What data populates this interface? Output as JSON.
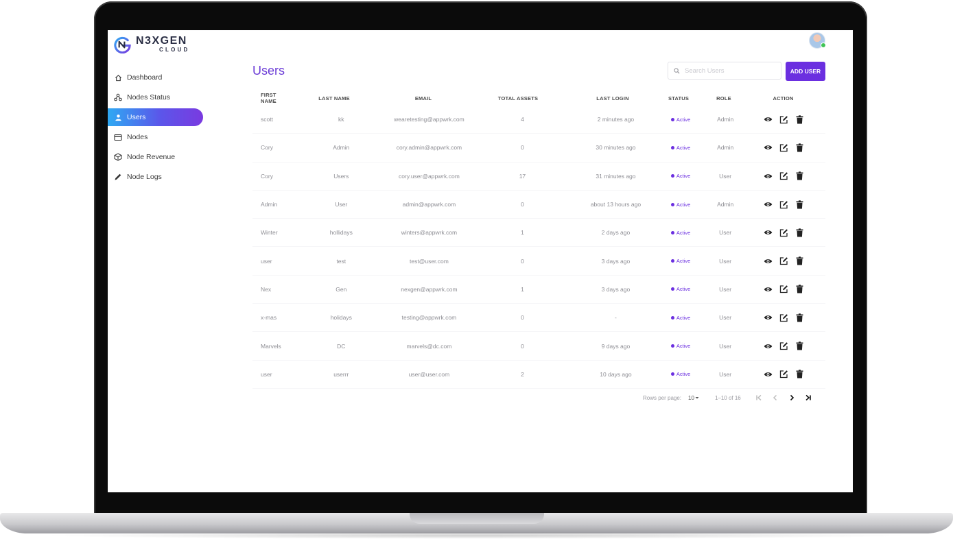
{
  "brand": {
    "name": "N3XGEN",
    "sub": "CLOUD",
    "accent": "#6b2fe0",
    "gradient_start": "#2fa9f3",
    "gradient_end": "#7a3ae0"
  },
  "sidebar": {
    "items": [
      {
        "label": "Dashboard",
        "icon": "home-icon"
      },
      {
        "label": "Nodes Status",
        "icon": "nodes-icon"
      },
      {
        "label": "Users",
        "icon": "user-icon",
        "active": true
      },
      {
        "label": "Nodes",
        "icon": "card-icon"
      },
      {
        "label": "Node Revenue",
        "icon": "cube-icon"
      },
      {
        "label": "Node Logs",
        "icon": "pencil-icon"
      }
    ]
  },
  "page": {
    "title": "Users"
  },
  "search": {
    "placeholder": "Search Users"
  },
  "toolbar": {
    "add_label": "ADD USER"
  },
  "table": {
    "columns": [
      "FIRST NAME",
      "LAST NAME",
      "EMAIL",
      "TOTAL ASSETS",
      "LAST LOGIN",
      "STATUS",
      "ROLE",
      "ACTION"
    ],
    "rows": [
      {
        "first": "scott",
        "last": "kk",
        "email": "wearetesting@appwrk.com",
        "assets": "4",
        "login": "2 minutes ago",
        "status": "Active",
        "role": "Admin"
      },
      {
        "first": "Cory",
        "last": "Admin",
        "email": "cory.admin@appwrk.com",
        "assets": "0",
        "login": "30 minutes ago",
        "status": "Active",
        "role": "Admin"
      },
      {
        "first": "Cory",
        "last": "Users",
        "email": "cory.user@appwrk.com",
        "assets": "17",
        "login": "31 minutes ago",
        "status": "Active",
        "role": "User"
      },
      {
        "first": "Admin",
        "last": "User",
        "email": "admin@appwrk.com",
        "assets": "0",
        "login": "about 13 hours ago",
        "status": "Active",
        "role": "Admin"
      },
      {
        "first": "Winter",
        "last": "hollidays",
        "email": "winters@appwrk.com",
        "assets": "1",
        "login": "2 days ago",
        "status": "Active",
        "role": "User"
      },
      {
        "first": "user",
        "last": "test",
        "email": "test@user.com",
        "assets": "0",
        "login": "3 days ago",
        "status": "Active",
        "role": "User"
      },
      {
        "first": "Nex",
        "last": "Gen",
        "email": "nexgen@appwrk.com",
        "assets": "1",
        "login": "3 days ago",
        "status": "Active",
        "role": "User"
      },
      {
        "first": "x-mas",
        "last": "holidays",
        "email": "testing@appwrk.com",
        "assets": "0",
        "login": "-",
        "status": "Active",
        "role": "User"
      },
      {
        "first": "Marvels",
        "last": "DC",
        "email": "marvels@dc.com",
        "assets": "0",
        "login": "9 days ago",
        "status": "Active",
        "role": "User"
      },
      {
        "first": "user",
        "last": "userrr",
        "email": "user@user.com",
        "assets": "2",
        "login": "10 days ago",
        "status": "Active",
        "role": "User"
      }
    ]
  },
  "pagination": {
    "rows_label": "Rows per page:",
    "rows_value": "10",
    "range": "1–10 of 16"
  }
}
